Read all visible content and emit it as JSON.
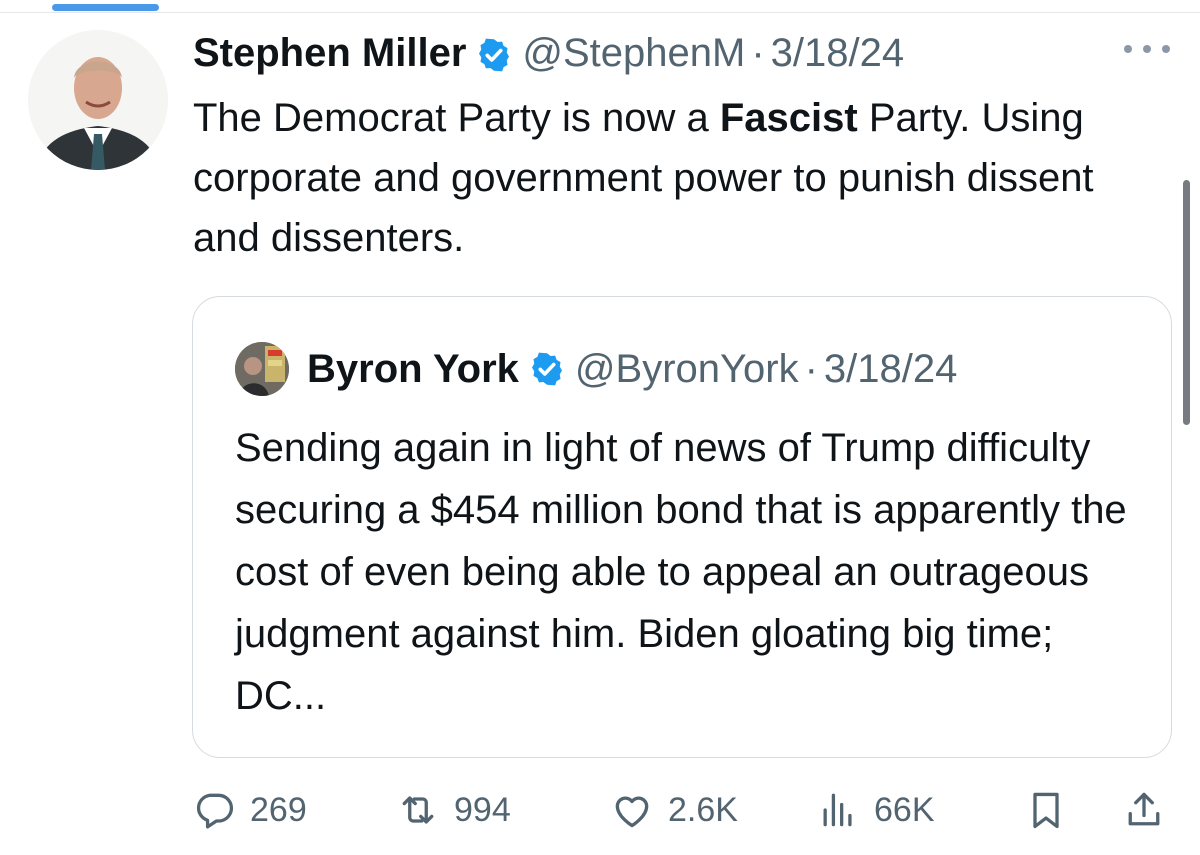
{
  "tweet": {
    "author_name": "Stephen Miller",
    "handle": "@StephenM",
    "separator": "·",
    "date": "3/18/24",
    "text_before_bold": "The Democrat Party is now a ",
    "text_bold": "Fascist",
    "text_after_bold": " Party. Using corporate and government power to punish dissent and dissenters."
  },
  "quoted_tweet": {
    "author_name": "Byron York",
    "handle": "@ByronYork",
    "separator": "·",
    "date": "3/18/24",
    "text": "Sending again in light of news of Trump difficulty securing a $454 million bond that is apparently the cost of even being able to appeal an outrageous judgment against him. Biden gloating big time; DC..."
  },
  "actions": {
    "replies": "269",
    "reposts": "994",
    "likes": "2.6K",
    "views": "66K"
  },
  "icons": {
    "verified": "verified-badge-icon",
    "more": "more-options-icon",
    "reply": "reply-icon",
    "repost": "repost-icon",
    "like": "like-icon",
    "views": "views-icon",
    "bookmark": "bookmark-icon",
    "share": "share-icon"
  },
  "colors": {
    "verified_blue": "#1d9bf0",
    "text": "#0f1419",
    "secondary": "#536471",
    "border": "#d6dbdf",
    "tab_indicator": "#4a99e9"
  }
}
